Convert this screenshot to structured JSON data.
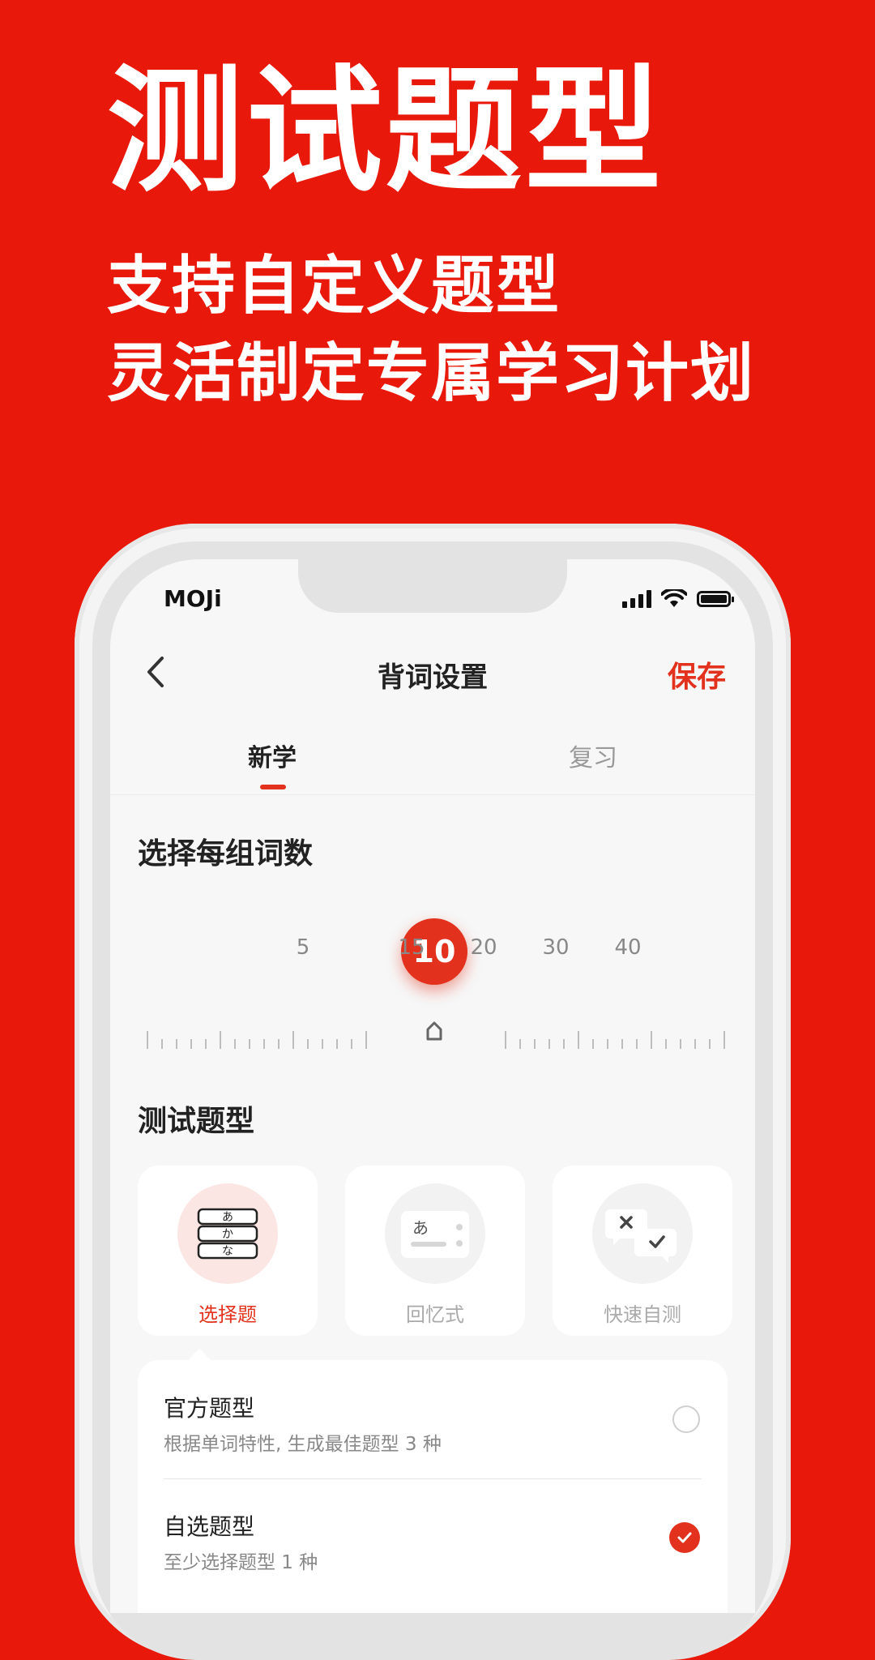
{
  "promo": {
    "title": "测试题型",
    "subtitle_line1": "支持自定义题型",
    "subtitle_line2": "灵活制定专属学习计划"
  },
  "status_bar": {
    "carrier": "MOJi",
    "icons": [
      "signal-icon",
      "wifi-icon",
      "battery-icon"
    ]
  },
  "nav": {
    "back_icon": "chevron-left-icon",
    "title": "背词设置",
    "save_label": "保存"
  },
  "tabs": [
    {
      "label": "新学",
      "active": true
    },
    {
      "label": "复习",
      "active": false
    }
  ],
  "word_count": {
    "title": "选择每组词数",
    "options": [
      "5",
      "10",
      "15",
      "20",
      "30",
      "40"
    ],
    "selected": "10"
  },
  "test_types": {
    "title": "测试题型",
    "cards": [
      {
        "label": "选择题",
        "icon": "choice-stack-icon",
        "active": true,
        "kana": [
          "あ",
          "か",
          "な"
        ]
      },
      {
        "label": "回忆式",
        "icon": "recall-card-icon",
        "active": false,
        "kana": [
          "あ"
        ]
      },
      {
        "label": "快速自测",
        "icon": "quick-test-bubbles-icon",
        "active": false
      }
    ]
  },
  "question_options": [
    {
      "title": "官方题型",
      "subtitle": "根据单词特性, 生成最佳题型 3 种",
      "checked": false
    },
    {
      "title": "自选题型",
      "subtitle": "至少选择题型 1 种",
      "checked": true
    }
  ],
  "colors": {
    "background": "#E8180A",
    "accent": "#E2321D",
    "muted_text": "#999999"
  }
}
